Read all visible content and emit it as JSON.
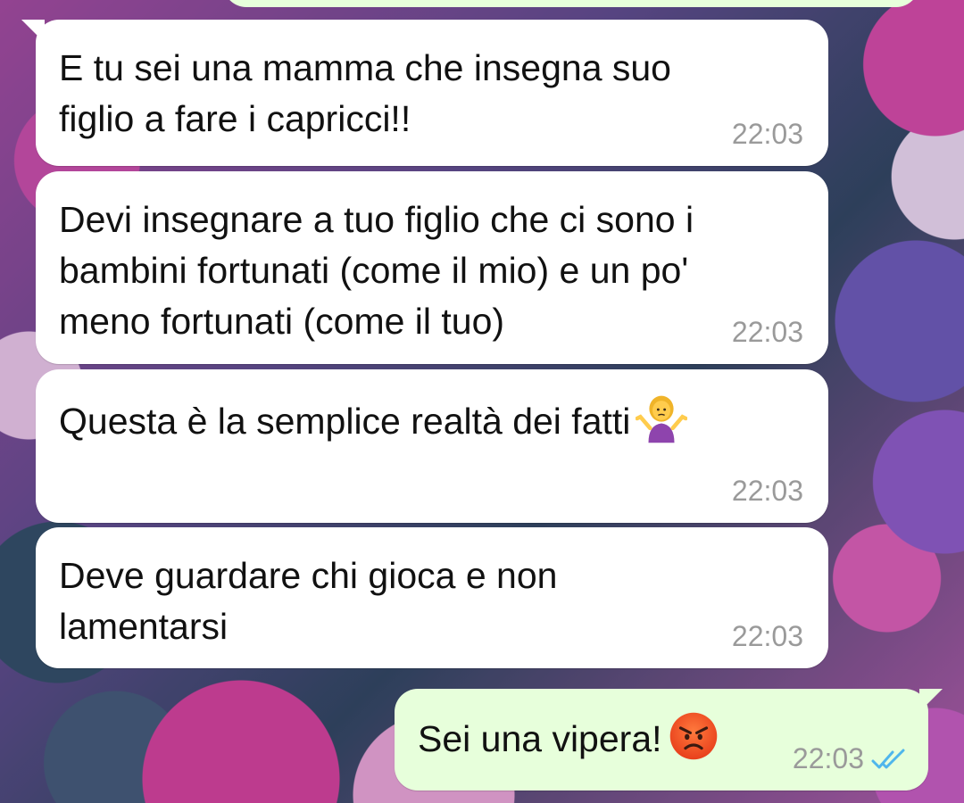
{
  "messages": [
    {
      "direction": "incoming",
      "text": "E tu sei una mamma che insegna suo\nfiglio a fare i capricci!!",
      "time": "22:03"
    },
    {
      "direction": "incoming",
      "text": "Devi insegnare a tuo figlio che ci sono i\nbambini fortunati (come il mio) e un po'\nmeno fortunati (come il tuo)",
      "time": "22:03"
    },
    {
      "direction": "incoming",
      "text": "Questa è la semplice realtà dei fatti",
      "emoji": "person-shrugging-emoji",
      "time": "22:03"
    },
    {
      "direction": "incoming",
      "text": "Deve guardare chi gioca e non\nlamentarsi",
      "time": "22:03"
    },
    {
      "direction": "outgoing",
      "text": "Sei una vipera!",
      "emoji": "angry-face-emoji",
      "time": "22:03",
      "status_icon": "double-check-read-icon"
    }
  ],
  "colors": {
    "incoming_bubble": "#ffffff",
    "outgoing_bubble": "#e7ffdb",
    "time_text": "#9a9a9a",
    "read_ticks": "#4fb6ec"
  }
}
